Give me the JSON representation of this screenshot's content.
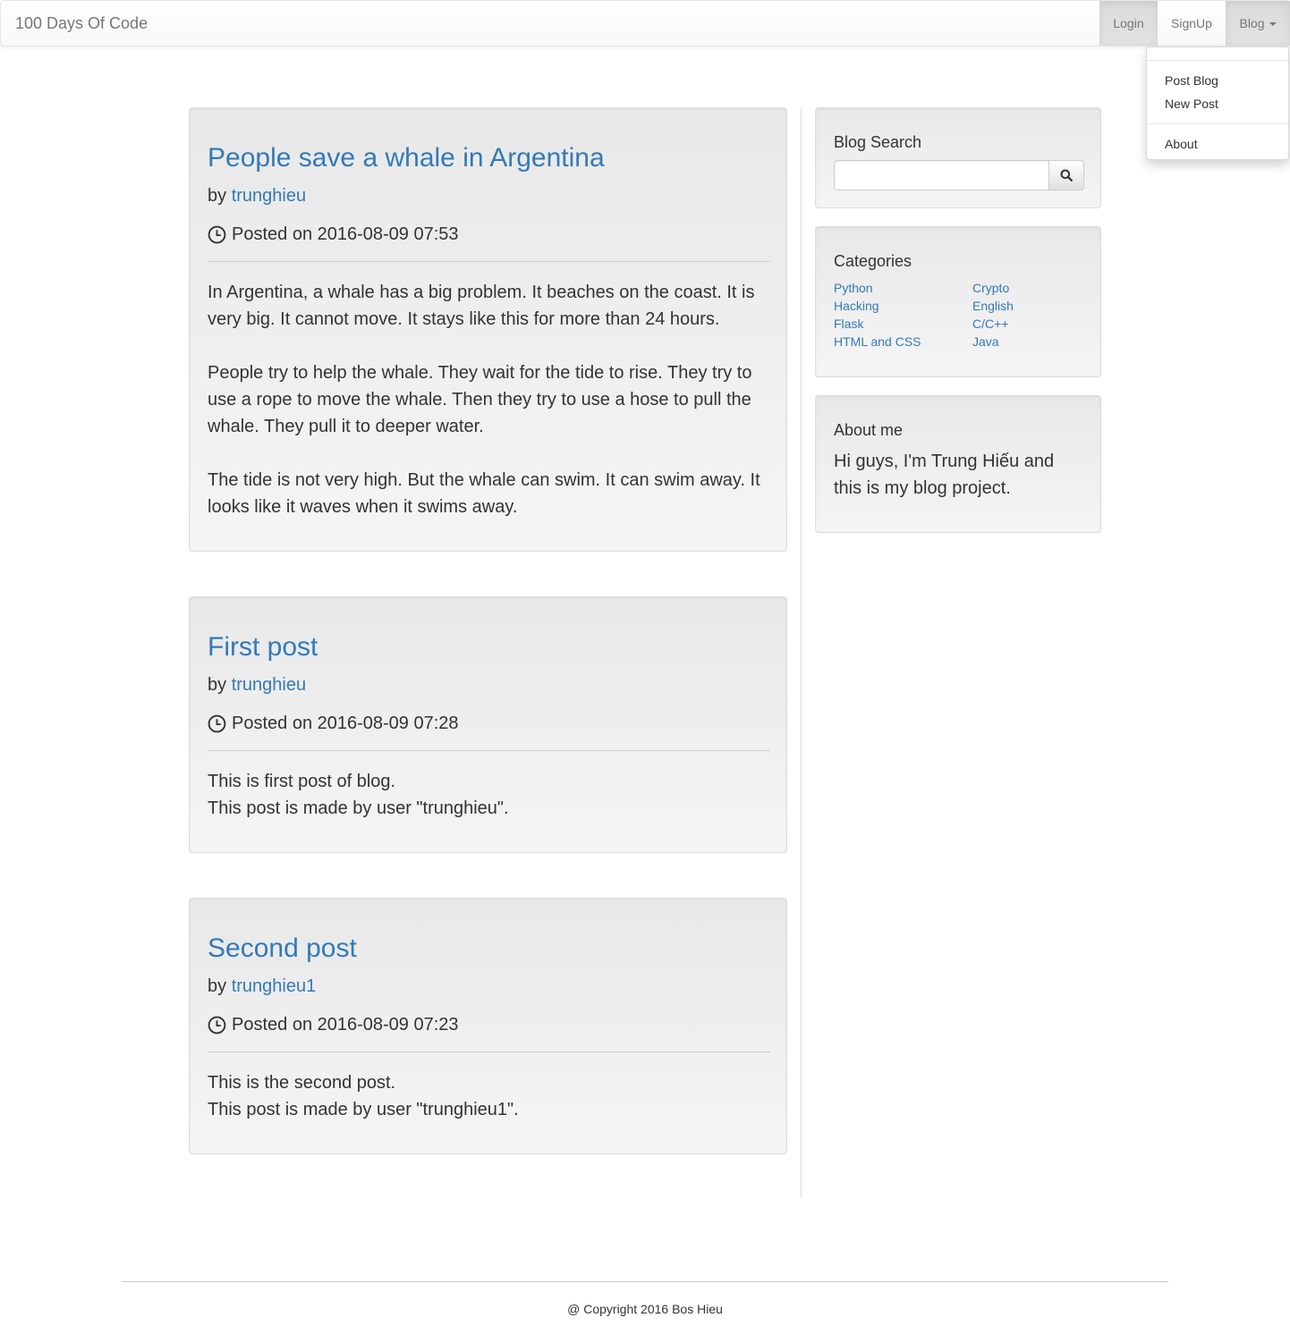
{
  "navbar": {
    "brand": "100 Days Of Code",
    "login_label": "Login",
    "signup_label": "SignUp",
    "blog_label": "Blog"
  },
  "dropdown": {
    "items": [
      "Post Blog",
      "New Post",
      "About"
    ]
  },
  "posts": [
    {
      "title": "People save a whale in Argentina",
      "by_label": "by",
      "author": "trunghieu",
      "date": "Posted on 2016-08-09 07:53",
      "paragraphs": [
        "In Argentina, a whale has a big problem. It beaches on the coast. It is very big. It cannot move. It stays like this for more than 24 hours.",
        "People try to help the whale. They wait for the tide to rise. They try to use a rope to move the whale. Then they try to use a hose to pull the whale. They pull it to deeper water.",
        "The tide is not very high. But the whale can swim. It can swim away. It looks like it waves when it swims away."
      ]
    },
    {
      "title": "First post",
      "by_label": "by",
      "author": "trunghieu",
      "date": "Posted on 2016-08-09 07:28",
      "paragraphs": [
        "This is first post of blog.",
        "This post is made by user \"trunghieu\"."
      ]
    },
    {
      "title": "Second post",
      "by_label": "by",
      "author": "trunghieu1",
      "date": "Posted on 2016-08-09 07:23",
      "paragraphs": [
        "This is the second post.",
        "This post is made by user \"trunghieu1\"."
      ]
    }
  ],
  "sidebar": {
    "search_heading": "Blog Search",
    "search_value": "",
    "categories_heading": "Categories",
    "categories_left": [
      "Python",
      "Hacking",
      "Flask",
      "HTML and CSS"
    ],
    "categories_right": [
      "Crypto",
      "English",
      "C/C++",
      "Java"
    ],
    "about_heading": "About me",
    "about_text": "Hi guys, I'm Trung Hiếu and this is my blog project."
  },
  "footer": {
    "copyright": "@ Copyright 2016 Bos Hieu"
  },
  "colors": {
    "link": "#337ab7",
    "text": "#333333",
    "nav_text": "#777777"
  }
}
